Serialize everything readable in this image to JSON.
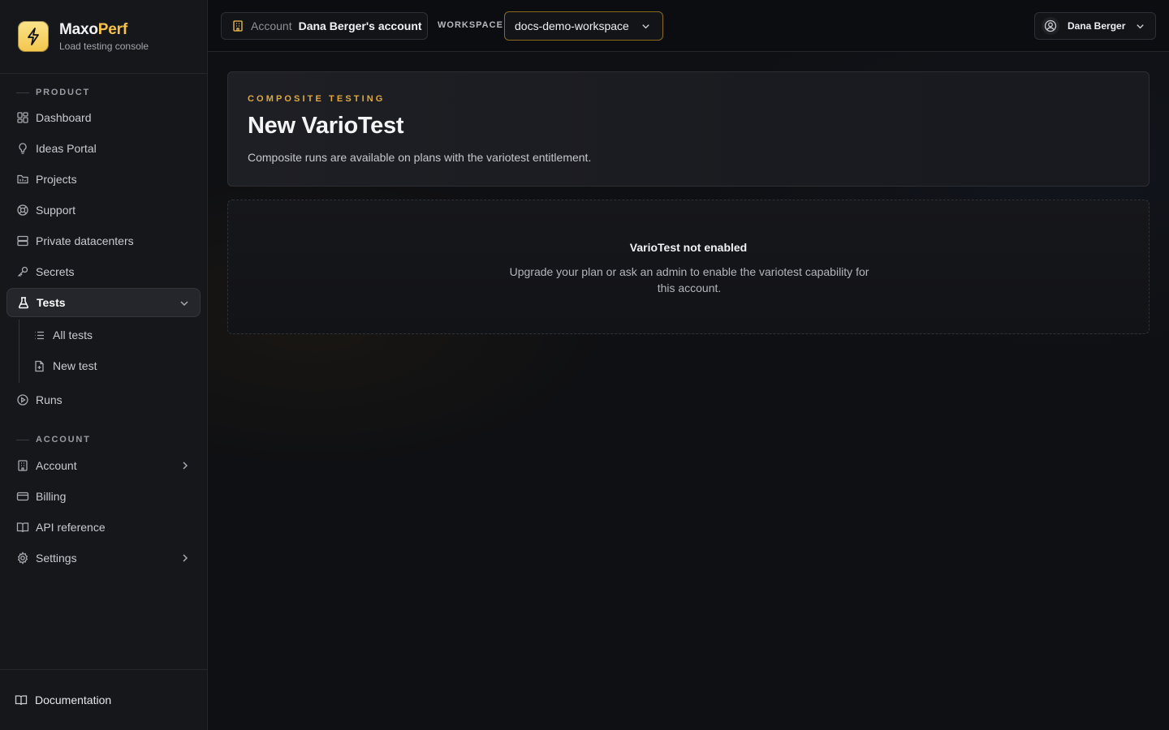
{
  "brand": {
    "name_part1": "Maxo",
    "name_part2": "Perf",
    "subtitle": "Load testing console",
    "logo_icon": "bolt-icon",
    "accent_color": "#f5c24a"
  },
  "sidebar": {
    "product_heading": "PRODUCT",
    "product_items": [
      {
        "label": "Dashboard",
        "icon": "grid-icon"
      },
      {
        "label": "Ideas Portal",
        "icon": "lightbulb-icon"
      },
      {
        "label": "Projects",
        "icon": "folder-icon"
      },
      {
        "label": "Support",
        "icon": "lifebuoy-icon"
      },
      {
        "label": "Private datacenters",
        "icon": "server-icon"
      },
      {
        "label": "Secrets",
        "icon": "key-icon"
      },
      {
        "label": "Tests",
        "icon": "flask-icon",
        "active": true,
        "expanded": true
      },
      {
        "label": "Runs",
        "icon": "play-circle-icon"
      }
    ],
    "tests_children": [
      {
        "label": "All tests",
        "icon": "list-icon"
      },
      {
        "label": "New test",
        "icon": "file-plus-icon"
      }
    ],
    "account_heading": "ACCOUNT",
    "account_items": [
      {
        "label": "Account",
        "icon": "building-icon",
        "has_children": true
      },
      {
        "label": "Billing",
        "icon": "credit-card-icon"
      },
      {
        "label": "API reference",
        "icon": "book-icon"
      },
      {
        "label": "Settings",
        "icon": "gear-icon",
        "has_children": true
      }
    ],
    "footer_link": "Documentation"
  },
  "topbar": {
    "account_label": "Account",
    "account_value": "Dana Berger's account",
    "workspace_label": "WORKSPACE",
    "workspace_value": "docs-demo-workspace",
    "user_name": "Dana Berger"
  },
  "page": {
    "eyebrow": "COMPOSITE TESTING",
    "title": "New VarioTest",
    "description": "Composite runs are available on plans with the variotest entitlement.",
    "empty_title": "VarioTest not enabled",
    "empty_description": "Upgrade your plan or ask an admin to enable the variotest capability for this account."
  }
}
